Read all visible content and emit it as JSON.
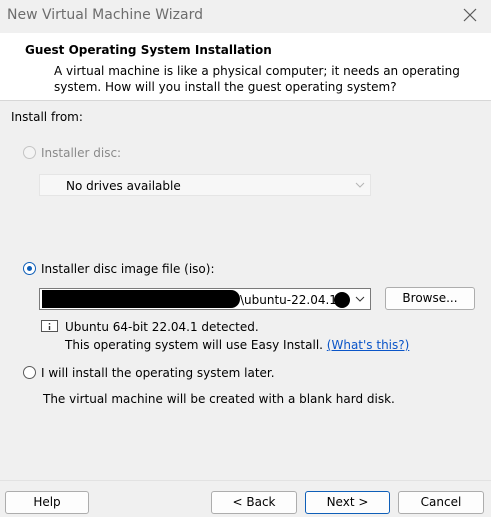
{
  "window": {
    "title": "New Virtual Machine Wizard"
  },
  "header": {
    "title": "Guest Operating System Installation",
    "description": "A virtual machine is like a physical computer; it needs an operating system. How will you install the guest operating system?"
  },
  "install_from": {
    "label": "Install from:",
    "options": {
      "disc": {
        "label": "Installer disc:",
        "selected": false,
        "enabled": false,
        "dropdown_value": "No drives available"
      },
      "iso": {
        "label": "Installer disc image file (iso):",
        "selected": true,
        "enabled": true,
        "path_visible": "\\ubuntu-22.04.1-",
        "browse_label": "Browse...",
        "detected_text": "Ubuntu 64-bit 22.04.1 detected.",
        "easy_install_text": "This operating system will use Easy Install.",
        "whats_this_link": "(What's this?)"
      },
      "later": {
        "label": "I will install the operating system later.",
        "selected": false,
        "description": "The virtual machine will be created with a blank hard disk."
      }
    }
  },
  "footer": {
    "help": "Help",
    "back": "< Back",
    "next": "Next >",
    "cancel": "Cancel"
  },
  "colors": {
    "accent": "#0f5fb8",
    "link": "#0a55c8"
  }
}
